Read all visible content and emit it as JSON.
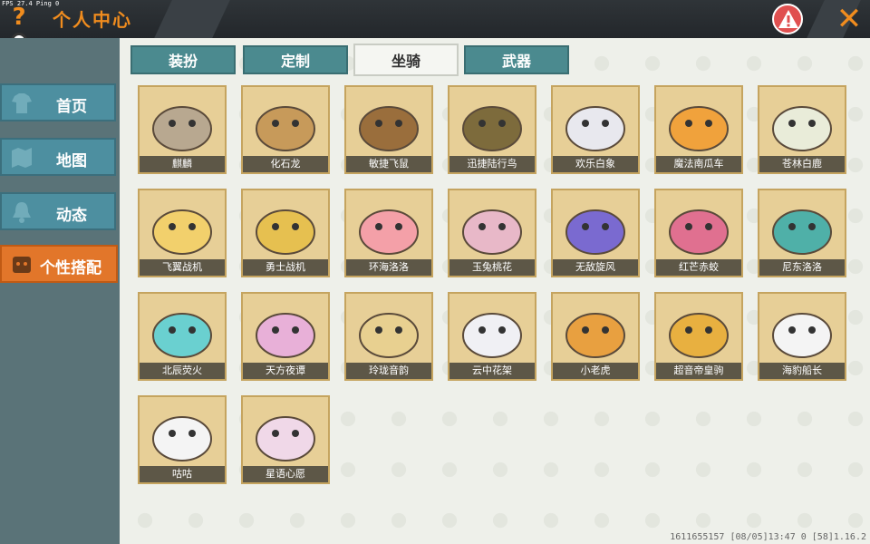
{
  "header": {
    "fps_text": "FPS 27.4  Ping 0",
    "help_label": "?",
    "title": "个人中心",
    "close_label": "✕"
  },
  "sidebar": {
    "items": [
      {
        "label": "首页",
        "icon": "shirt-icon",
        "active": false
      },
      {
        "label": "地图",
        "icon": "map-icon",
        "active": false
      },
      {
        "label": "动态",
        "icon": "bell-icon",
        "active": false
      },
      {
        "label": "个性搭配",
        "icon": "character-icon",
        "active": true
      }
    ]
  },
  "tabs": [
    {
      "label": "装扮",
      "active": false
    },
    {
      "label": "定制",
      "active": false
    },
    {
      "label": "坐骑",
      "active": true
    },
    {
      "label": "武器",
      "active": false
    }
  ],
  "mounts": [
    {
      "name": "麒麟",
      "color": "#b8a890"
    },
    {
      "name": "化石龙",
      "color": "#c79a5a"
    },
    {
      "name": "敏捷飞鼠",
      "color": "#9a6e3c"
    },
    {
      "name": "迅捷陆行鸟",
      "color": "#7d6b3c"
    },
    {
      "name": "欢乐白象",
      "color": "#e8e8ee"
    },
    {
      "name": "魔法南瓜车",
      "color": "#f0a23c"
    },
    {
      "name": "苍林白鹿",
      "color": "#e9ecd9"
    },
    {
      "name": "飞翼战机",
      "color": "#f2d06c"
    },
    {
      "name": "勇士战机",
      "color": "#e6c050"
    },
    {
      "name": "环海洛洛",
      "color": "#f4a0a8"
    },
    {
      "name": "玉兔桃花",
      "color": "#e8b8c8"
    },
    {
      "name": "无敌旋风",
      "color": "#7a6ad0"
    },
    {
      "name": "红芒赤蛟",
      "color": "#e07090"
    },
    {
      "name": "尼东洛洛",
      "color": "#4fb0a8"
    },
    {
      "name": "北辰荧火",
      "color": "#6ad0d0"
    },
    {
      "name": "天方夜谭",
      "color": "#e8b0d8"
    },
    {
      "name": "玲珑音韵",
      "color": "#e8d090"
    },
    {
      "name": "云中花架",
      "color": "#f0f0f4"
    },
    {
      "name": "小老虎",
      "color": "#e8a040"
    },
    {
      "name": "超音帝皇驹",
      "color": "#e8b040"
    },
    {
      "name": "海豹船长",
      "color": "#f4f4f4"
    },
    {
      "name": "咕咕",
      "color": "#f4f4f4"
    },
    {
      "name": "星语心愿",
      "color": "#f0d8e8"
    }
  ],
  "footer": {
    "build_text": "1611655157    [08/05]13:47 0  [58]1.16.2"
  },
  "colors": {
    "accent": "#f08c1e",
    "sidebar_active": "#e2762a",
    "tab_active_bg": "#f5f6f2",
    "tab_bg": "#4b8a8f",
    "card_bg": "#e7cf97"
  }
}
